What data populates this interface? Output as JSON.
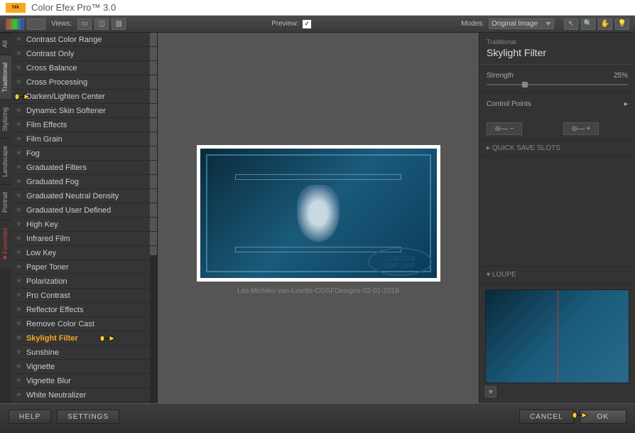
{
  "title": "Color Efex Pro™ 3.0",
  "logo": "Nik",
  "toolbar": {
    "views": "Views:",
    "preview": "Preview:",
    "modes": "Modes:",
    "modes_value": "Original Image"
  },
  "side_tabs": [
    "All",
    "Traditional",
    "Stylizing",
    "Landscape",
    "Portrait",
    "Favorites"
  ],
  "filters": [
    "Contrast Color Range",
    "Contrast Only",
    "Cross Balance",
    "Cross Processing",
    "Darken/Lighten Center",
    "Dynamic Skin Softener",
    "Film Effects",
    "Film Grain",
    "Fog",
    "Graduated Filters",
    "Graduated Fog",
    "Graduated Neutral Density",
    "Graduated User Defined",
    "High Key",
    "Infrared Film",
    "Low Key",
    "Paper Toner",
    "Polarization",
    "Pro Contrast",
    "Reflector Effects",
    "Remove Color Cast",
    "Skylight Filter",
    "Sunshine",
    "Vignette",
    "Vignette Blur",
    "White Neutralizer"
  ],
  "selected_filter": "Skylight Filter",
  "preview": {
    "filename": "Les-Michiko-van-Linette-CGSFDesigns-02-01-2018",
    "watermark_name": "CLAUDIA",
    "watermark_coords": "(1047 : 594)"
  },
  "right": {
    "category": "Traditional",
    "title": "Skylight Filter",
    "strength_label": "Strength",
    "strength_value": "25%",
    "control_points": "Control Points",
    "quick_save": "QUICK SAVE SLOTS",
    "loupe": "LOUPE"
  },
  "footer": {
    "help": "HELP",
    "settings": "SETTINGS",
    "cancel": "CANCEL",
    "ok": "OK"
  }
}
